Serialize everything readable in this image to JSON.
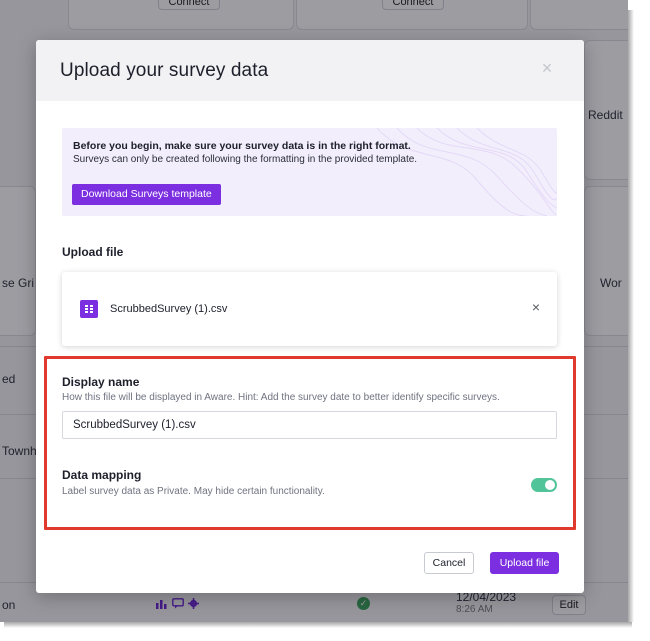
{
  "background": {
    "connect_left": "Connect",
    "connect_right": "Connect",
    "card_reddit": "Reddit",
    "card_grid": "se Gri",
    "card_wor": "Wor",
    "row_ed": "ed",
    "row_townha": "Townha",
    "row_on": "on",
    "row_date": "12/04/2023",
    "row_time": "8:26 AM",
    "edit_label": "Edit",
    "check_glyph": "✓",
    "row_icons": [
      "bar-chart-icon",
      "chat-icon",
      "gear-icon"
    ]
  },
  "modal": {
    "title": "Upload your survey data",
    "close_glyph": "×",
    "info": {
      "title": "Before you begin, make sure your survey data is in the right format.",
      "subtitle": "Surveys can only be created following the formatting in the provided template.",
      "download_label": "Download Surveys template"
    },
    "upload_file_label": "Upload file",
    "file": {
      "name": "ScrubbedSurvey (1).csv",
      "remove_glyph": "×",
      "icon": "spreadsheet-icon"
    },
    "display_name": {
      "label": "Display name",
      "hint": "How this file will be displayed in Aware. Hint: Add the survey date to better identify specific surveys.",
      "value": "ScrubbedSurvey (1).csv"
    },
    "data_mapping": {
      "label": "Data mapping",
      "description": "Label survey data as Private. May hide certain functionality.",
      "toggle_on": true
    },
    "cancel_label": "Cancel",
    "upload_label": "Upload file"
  },
  "colors": {
    "accent": "#7b2fe0",
    "toggle": "#52c49a",
    "highlight": "#e03a2f"
  }
}
